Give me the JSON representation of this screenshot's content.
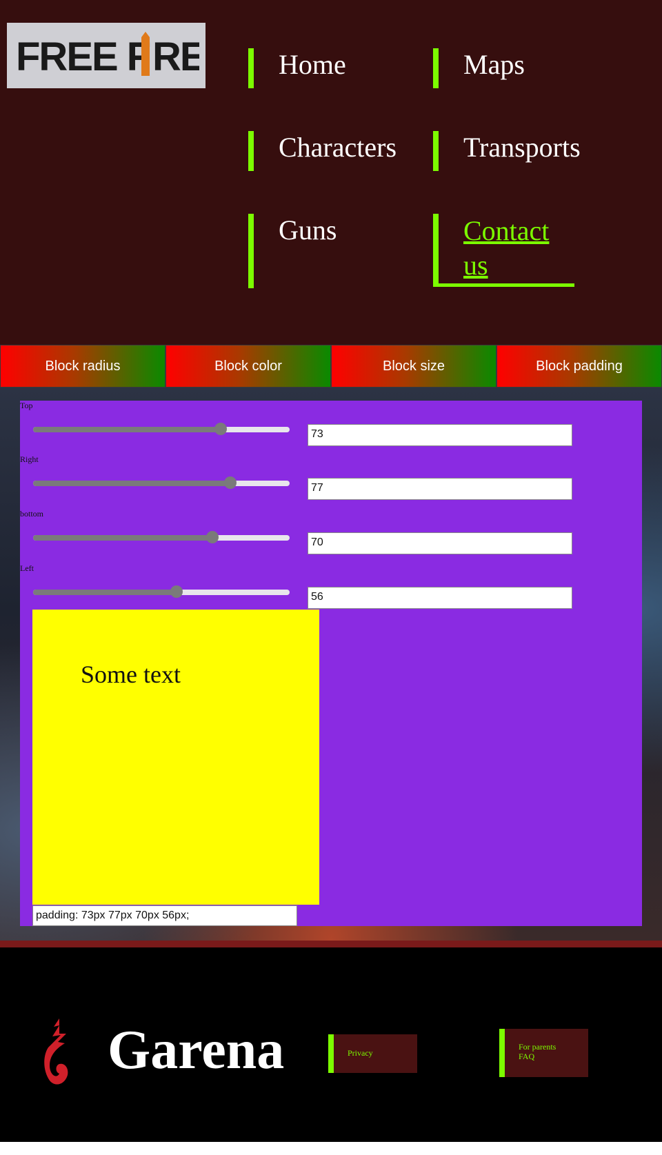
{
  "header": {
    "logo_text": "FREE FIRE",
    "nav": {
      "home": "Home",
      "maps": "Maps",
      "characters": "Characters",
      "transports": "Transports",
      "guns": "Guns",
      "contact_line1": "Contact",
      "contact_line2": "us"
    },
    "accent_color": "#7cfc00"
  },
  "tabs": [
    "Block radius",
    "Block color",
    "Block size",
    "Block padding"
  ],
  "padding_panel": {
    "sliders": [
      {
        "label": "Top",
        "value": "73",
        "fraction": 0.73
      },
      {
        "label": "Right",
        "value": "77",
        "fraction": 0.77
      },
      {
        "label": "bottom",
        "value": "70",
        "fraction": 0.7
      },
      {
        "label": "Left",
        "value": "56",
        "fraction": 0.56
      }
    ],
    "demo_text": "Some text",
    "output": "padding: 73px 77px 70px 56px;",
    "panel_color": "#8a2be2",
    "block_color": "#ffff00"
  },
  "footer": {
    "brand": "Garena",
    "links": {
      "privacy": "Privacy",
      "parents": "For parents",
      "faq": "FAQ"
    }
  }
}
